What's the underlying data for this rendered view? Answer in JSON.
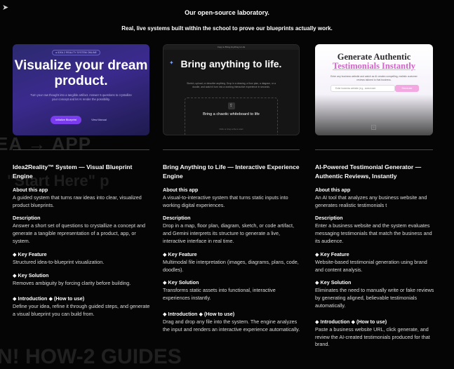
{
  "corner_icon": "arrow-icon",
  "background_ghost": {
    "line1": "EA → APP",
    "line2": "\"Start Here\" p",
    "line3": "N! HOW-2 GUIDES"
  },
  "header": {
    "title": "Our open-source laboratory.",
    "subtitle": "Real, live systems built within the school to prove our blueprints actually work."
  },
  "cards": [
    {
      "thumb": {
        "pill": "● IDEA 2 REALITY SYSTEM ONLINE",
        "headline": "Visualize your dream product.",
        "body": "Turn your raw thought into a tangible artifact. Answer 5 questions to crystallize your concept and let AI render the possibility.",
        "primary_btn": "Initialize Blueprint",
        "secondary_btn": "View Manual"
      },
      "title": "Idea2Reality™ System — Visual Blueprint Engine",
      "about_h": "About this app",
      "about": "A guided system that turns raw ideas into clear, visualized product blueprints.",
      "desc_h": "Description",
      "desc": "Answer a short set of questions to crystallize a concept and generate a tangible representation of a product, app, or system.",
      "feature_h": "◆ Key Feature",
      "feature": "Structured idea-to-blueprint visualization.",
      "solution_h": "◆ Key Solution",
      "solution": "Removes ambiguity by forcing clarity before building.",
      "intro_h": "◆ Introduction ◆ (How to use)",
      "intro": "Define your idea, refine it through guided steps, and generate a visual blueprint you can build from."
    },
    {
      "thumb": {
        "topbar": "Copy to Bring Anything to Life",
        "headline": "Bring anything to life.",
        "body": "Sketch, upload, or describe anything. Drop in a drawing, a floor plan, a diagram, or a doodle, and watch it turn into a working interactive experience in seconds.",
        "drop_text": "Bring a chaotic whiteboard to life",
        "drop_sub": "Click or drop a file to start"
      },
      "title": "Bring Anything to Life — Interactive Experience Engine",
      "about_h": "About this app",
      "about": "A visual-to-interactive system that turns static inputs into working digital experiences.",
      "desc_h": "Description",
      "desc": "Drop in a map, floor plan, diagram, sketch, or code artifact, and Gemini interprets its structure to generate a live, interactive interface in real time.",
      "feature_h": "◆ Key Feature",
      "feature": "Multimodal file interpretation (images, diagrams, plans, code, doodles).",
      "solution_h": "◆ Key Solution",
      "solution": "Transforms static assets into functional, interactive experiences instantly.",
      "intro_h": "◆ Introduction ◆ (How to use)",
      "intro": "Drag and drop any file into the system. The engine analyzes the input and renders an interactive experience automatically."
    },
    {
      "thumb": {
        "headline1": "Generate Authentic",
        "headline2": "Testimonials Instantly",
        "body": "Enter any business website and watch as AI creates compelling, realistic customer reviews tailored to that business.",
        "input_placeholder": "Enter business website (e.g., www.exam",
        "generate_btn": "Generate"
      },
      "title": "AI-Powered Testimonial Generator — Authentic Reviews, Instantly",
      "about_h": "About this app",
      "about": "An AI tool that analyzes any business website and generates realistic testimonials t",
      "desc_h": "Description",
      "desc": "Enter a business website and the system evaluates messaging testimonials that match the business and its audience.",
      "feature_h": "◆ Key Feature",
      "feature": "Website-based testimonial generation using brand and content analysis.",
      "solution_h": "◆ Key Solution",
      "solution": "Eliminates the need to manually write or fake reviews by generating aligned, believable testimonials automatically.",
      "intro_h": "◆ Introduction ◆ (How to use)",
      "intro": "Paste a business website URL, click generate, and review the AI-created testimonials produced for that brand."
    }
  ]
}
